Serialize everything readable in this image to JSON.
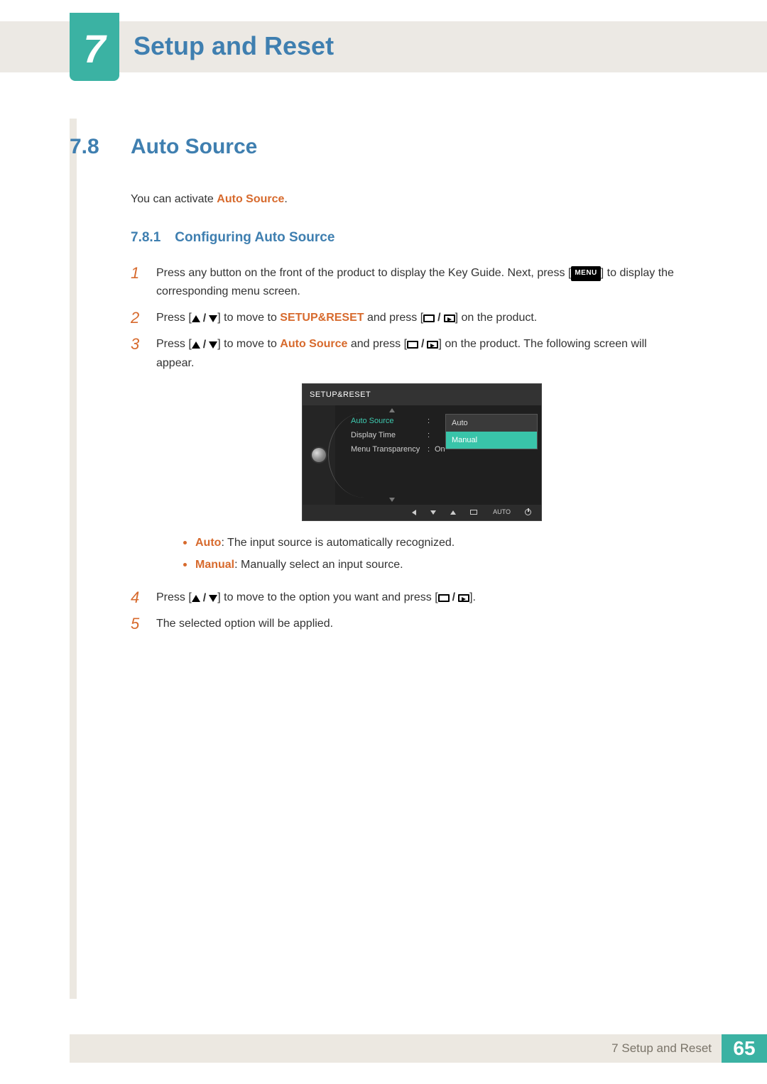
{
  "chapter": {
    "number": "7",
    "title": "Setup and Reset"
  },
  "section": {
    "number": "7.8",
    "title": "Auto Source"
  },
  "intro": {
    "prefix": "You can activate ",
    "term": "Auto Source",
    "suffix": "."
  },
  "subsection": {
    "number": "7.8.1",
    "title": "Configuring Auto Source"
  },
  "steps": {
    "s1": {
      "num": "1",
      "a": "Press any button on the front of the product to display the Key Guide. Next, press [",
      "menu": "MENU",
      "b": "] to display the corresponding menu screen."
    },
    "s2": {
      "num": "2",
      "a": "Press [",
      "b": "] to move to ",
      "target": "SETUP&RESET",
      "c": " and press [",
      "d": "] on the product."
    },
    "s3": {
      "num": "3",
      "a": "Press [",
      "b": "] to move to ",
      "target": "Auto Source",
      "c": " and press [",
      "d": "] on the product. The following screen will appear."
    },
    "s4": {
      "num": "4",
      "a": "Press [",
      "b": "] to move to the option you want and press [",
      "c": "]."
    },
    "s5": {
      "num": "5",
      "text": "The selected option will be applied."
    }
  },
  "osd": {
    "header": "SETUP&RESET",
    "rows": {
      "r1": {
        "label": "Auto Source",
        "val": "Auto"
      },
      "r2": {
        "label": "Display Time",
        "val": ""
      },
      "r3": {
        "label": "Menu Transparency",
        "val": "On"
      }
    },
    "popup": {
      "opt1": "Auto",
      "opt2": "Manual"
    },
    "footer_auto": "AUTO"
  },
  "bullets": {
    "b1": {
      "term": "Auto",
      "text": ": The input source is automatically recognized."
    },
    "b2": {
      "term": "Manual",
      "text": ": Manually select an input source."
    }
  },
  "footer": {
    "label": "7 Setup and Reset",
    "page": "65"
  }
}
